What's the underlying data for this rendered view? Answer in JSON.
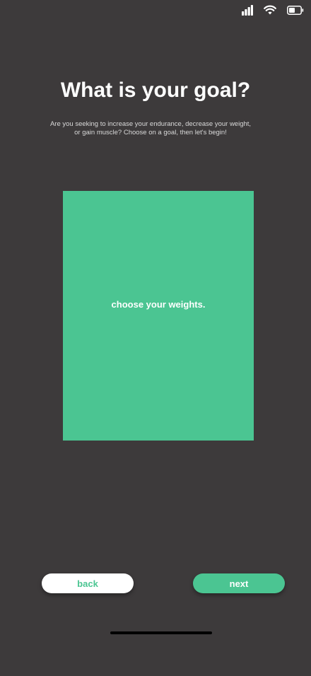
{
  "status_bar": {
    "icons": [
      "cellular-signal-icon",
      "wifi-icon",
      "battery-icon"
    ]
  },
  "header": {
    "title": "What is your goal?",
    "subtitle_line1": "Are you seeking to increase your endurance, decrease your weight,",
    "subtitle_line2": "or gain muscle? Choose on a goal, then let's begin!"
  },
  "goal_card": {
    "label": "choose your weights."
  },
  "navigation": {
    "back_label": "back",
    "next_label": "next"
  },
  "colors": {
    "background": "#3d3a3b",
    "accent_green": "#4bc592",
    "text_white": "#ffffff"
  }
}
